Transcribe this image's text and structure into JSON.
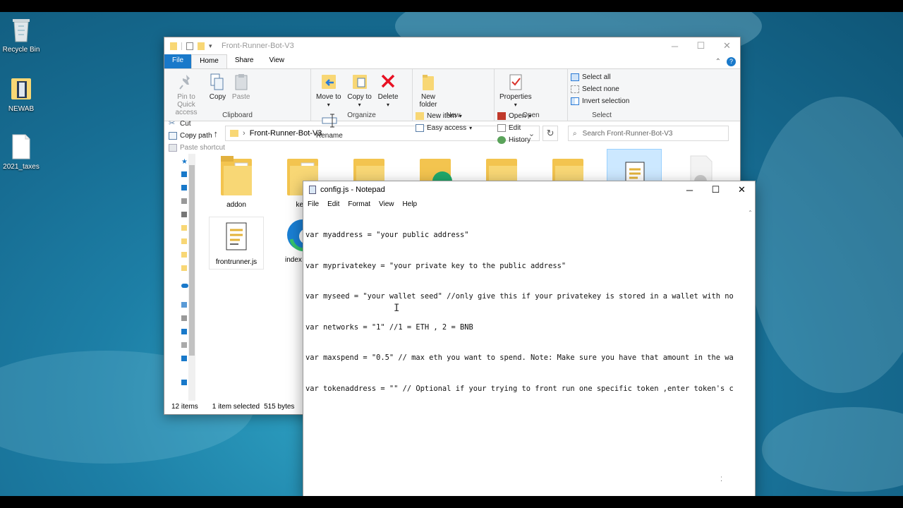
{
  "desktop": {
    "icons": [
      {
        "label": "Recycle Bin"
      },
      {
        "label": "NEWAB"
      },
      {
        "label": "2021_taxes"
      }
    ]
  },
  "explorer": {
    "title": "Front-Runner-Bot-V3",
    "tabs": {
      "file": "File",
      "home": "Home",
      "share": "Share",
      "view": "View"
    },
    "ribbon": {
      "clipboard": {
        "pin": "Pin to Quick access",
        "copy": "Copy",
        "paste": "Paste",
        "cut": "Cut",
        "copy_path": "Copy path",
        "paste_shortcut": "Paste shortcut",
        "label": "Clipboard"
      },
      "organize": {
        "move_to": "Move to",
        "copy_to": "Copy to",
        "delete": "Delete",
        "rename": "Rename",
        "label": "Organize"
      },
      "new": {
        "new_folder": "New folder",
        "new_item": "New item",
        "easy_access": "Easy access",
        "label": "New"
      },
      "open": {
        "properties": "Properties",
        "open": "Open",
        "edit": "Edit",
        "history": "History",
        "label": "Open"
      },
      "select": {
        "select_all": "Select all",
        "select_none": "Select none",
        "invert": "Invert selection",
        "label": "Select"
      }
    },
    "address": "Front-Runner-Bot-V3",
    "search_placeholder": "Search Front-Runner-Bot-V3",
    "items": [
      {
        "name": "addon"
      },
      {
        "name": "keyr"
      },
      {
        "name": "frontrunner.js"
      },
      {
        "name": "index"
      }
    ],
    "status": {
      "count": "12 items",
      "selection": "1 item selected",
      "size": "515 bytes"
    }
  },
  "notepad": {
    "title": "config.js - Notepad",
    "menu": {
      "file": "File",
      "edit": "Edit",
      "format": "Format",
      "view": "View",
      "help": "Help"
    },
    "lines": [
      "var myaddress = \"your public address\"",
      "var myprivatekey = \"your private key to the public address\"",
      "var myseed = \"your wallet seed\" //only give this if your privatekey is stored in a wallet with no",
      "var networks = \"1\" //1 = ETH , 2 = BNB",
      "var maxspend = \"0.5\" // max eth you want to spend. Note: Make sure you have that amount in the wa",
      "var tokenaddress = \"\" // Optional if your trying to front run one specific token ,enter token's c"
    ]
  },
  "colors": {
    "accent": "#1979ca",
    "folder": "#f8d775",
    "delete": "#e81123"
  }
}
